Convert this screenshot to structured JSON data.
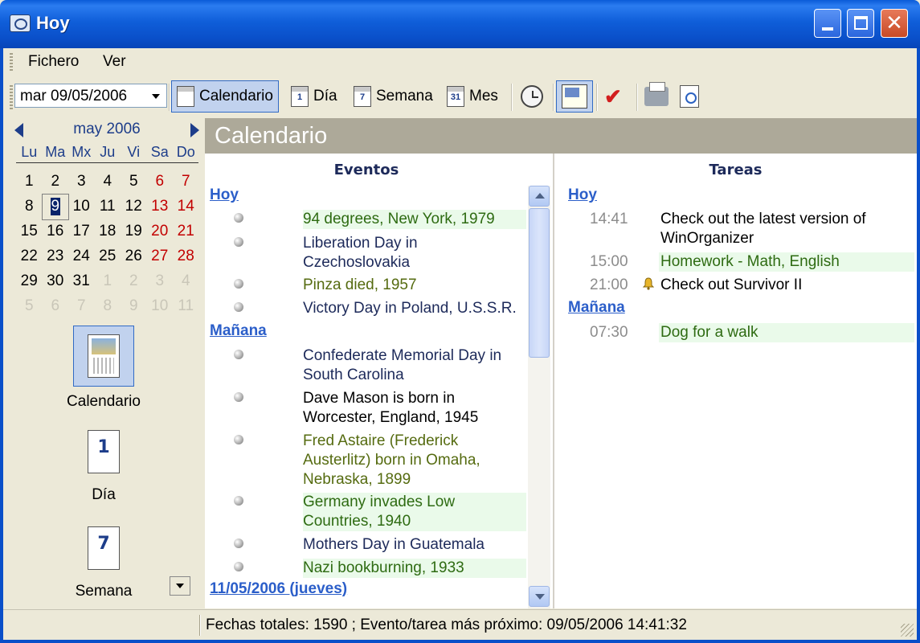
{
  "window": {
    "title": "Hoy"
  },
  "menu": {
    "items": [
      "Fichero",
      "Ver"
    ]
  },
  "toolbar": {
    "date_value": "mar 09/05/2006",
    "calendario_label": "Calendario",
    "dia_label": "Día",
    "semana_label": "Semana",
    "mes_label": "Mes",
    "dia_icon_num": "1",
    "semana_icon_num": "7",
    "mes_icon_num": "31"
  },
  "calendar": {
    "month": "may 2006",
    "weekdays": [
      "Lu",
      "Ma",
      "Mx",
      "Ju",
      "Vi",
      "Sa",
      "Do"
    ],
    "selected_day": "9"
  },
  "nav": {
    "calendario": "Calendario",
    "dia": "Día",
    "semana": "Semana",
    "dia_num": "1",
    "semana_num": "7"
  },
  "main": {
    "title": "Calendario",
    "events_header": "Eventos",
    "tasks_header": "Tareas"
  },
  "events": {
    "hoy_label": "Hoy",
    "manana_label": "Mañana",
    "next_label": "11/05/2006 (jueves)",
    "hoy": [
      "94 degrees, New York, 1979",
      "Liberation Day in Czechoslovakia",
      "Pinza died, 1957",
      "Victory Day in Poland, U.S.S.R."
    ],
    "manana": [
      "Confederate Memorial Day in South Carolina",
      "Dave Mason is born in Worcester, England, 1945",
      "Fred Astaire (Frederick Austerlitz) born in Omaha, Nebraska, 1899",
      "Germany invades Low Countries, 1940",
      "Mothers Day in Guatemala",
      "Nazi bookburning, 1933"
    ]
  },
  "tasks": {
    "hoy_label": "Hoy",
    "manana_label": "Mañana",
    "hoy": [
      {
        "time": "14:41",
        "text": "Check out the latest version of WinOrganizer"
      },
      {
        "time": "15:00",
        "text": "Homework - Math, English"
      },
      {
        "time": "21:00",
        "text": "Check out Survivor II"
      }
    ],
    "manana": [
      {
        "time": "07:30",
        "text": "Dog for a walk"
      }
    ]
  },
  "status": {
    "text": "Fechas totales: 1590 ; Evento/tarea más próximo: 09/05/2006 14:41:32"
  },
  "colors": {
    "accent": "#316ac5",
    "weekend": "#c20000",
    "link": "#2b5ec9",
    "highlight_row": "#eafaea"
  }
}
